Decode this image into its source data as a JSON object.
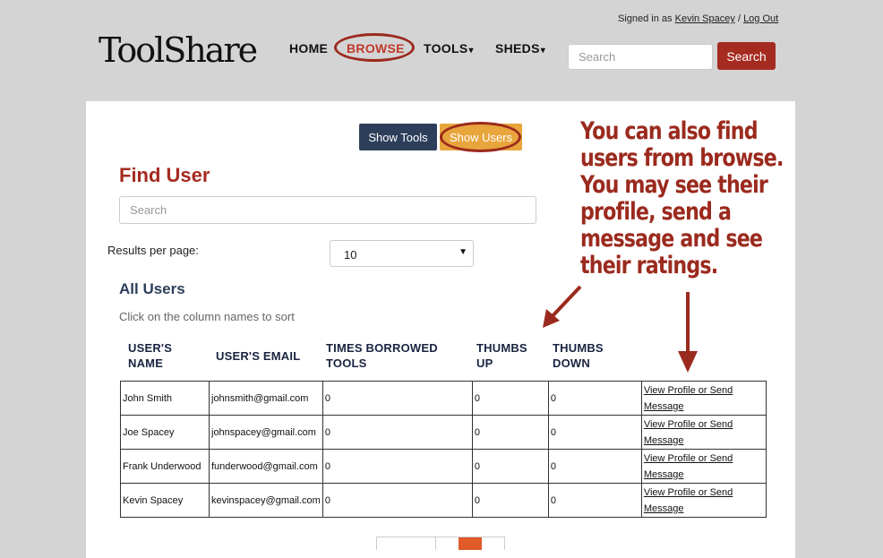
{
  "header": {
    "signed_prefix": "Signed in as",
    "user_name": "Kevin Spacey",
    "separator": "/",
    "logout": "Log Out",
    "logo": "ToolShare",
    "nav": [
      {
        "label": "HOME"
      },
      {
        "label": "BROWSE"
      },
      {
        "label": "TOOLS"
      },
      {
        "label": "SHEDS"
      }
    ],
    "search_placeholder": "Search",
    "search_button": "Search"
  },
  "toggle": {
    "show_tools": "Show Tools",
    "show_users": "Show Users"
  },
  "find_user": {
    "title": "Find User",
    "search_placeholder": "Search",
    "results_label": "Results per page:",
    "results_value": "10"
  },
  "all_users": {
    "title": "All Users",
    "hint": "Click on the column names to sort",
    "columns": [
      "USER'S NAME",
      "USER'S EMAIL",
      "TIMES BORROWED TOOLS",
      "THUMBS UP",
      "THUMBS DOWN"
    ],
    "rows": [
      {
        "name": "John Smith",
        "email": "johnsmith@gmail.com",
        "borrowed": "0",
        "up": "0",
        "down": "0",
        "link_a": "View Profile or Send",
        "link_b": "Message"
      },
      {
        "name": "Joe Spacey",
        "email": "johnspacey@gmail.com",
        "borrowed": "0",
        "up": "0",
        "down": "0",
        "link_a": "View Profile or Send",
        "link_b": "Message"
      },
      {
        "name": "Frank Underwood",
        "email": "funderwood@gmail.com",
        "borrowed": "0",
        "up": "0",
        "down": "0",
        "link_a": "View Profile or Send",
        "link_b": "Message"
      },
      {
        "name": "Kevin Spacey",
        "email": "kevinspacey@gmail.com",
        "borrowed": "0",
        "up": "0",
        "down": "0",
        "link_a": "View Profile or Send",
        "link_b": "Message"
      }
    ]
  },
  "annotation": {
    "lines": [
      "You can also find",
      "users from browse.",
      "You may see their",
      "profile, send a",
      "message and see",
      "their ratings."
    ]
  },
  "colors": {
    "accent": "#a52a1f",
    "navy": "#2c3e5a",
    "highlight": "#e8a53c"
  }
}
